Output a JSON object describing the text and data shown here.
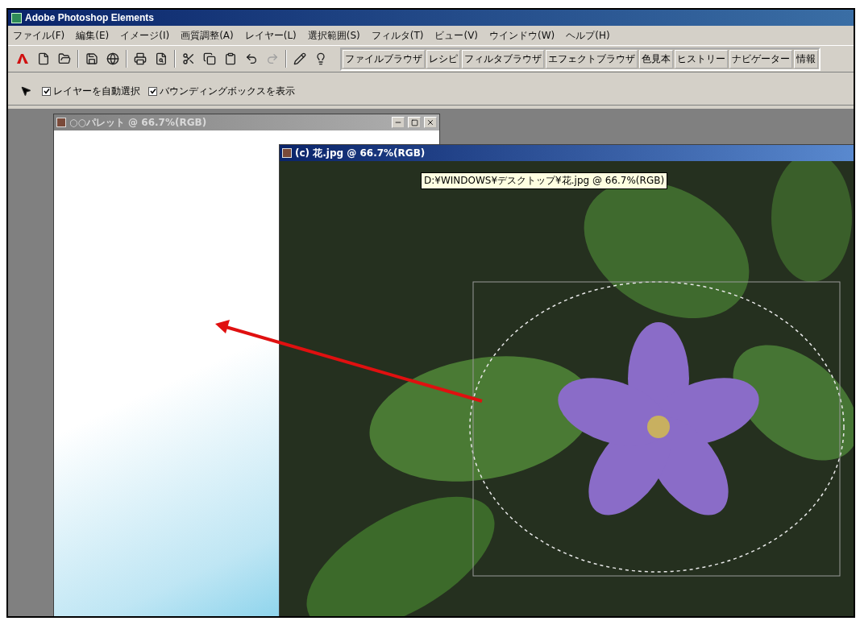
{
  "window": {
    "title": "Adobe Photoshop Elements"
  },
  "menu": [
    "ファイル(F)",
    "編集(E)",
    "イメージ(I)",
    "画質調整(A)",
    "レイヤー(L)",
    "選択範囲(S)",
    "フィルタ(T)",
    "ビュー(V)",
    "ウインドウ(W)",
    "ヘルプ(H)"
  ],
  "palette_tabs": [
    "ファイルブラウザ",
    "レシピ",
    "フィルタブラウザ",
    "エフェクトブラウザ",
    "色見本",
    "ヒストリー",
    "ナビゲーター",
    "情報"
  ],
  "options_bar": {
    "checkboxes": [
      {
        "label": "レイヤーを自動選択",
        "checked": true
      },
      {
        "label": "バウンディングボックスを表示",
        "checked": true
      }
    ]
  },
  "documents": [
    {
      "kind": "blank",
      "title": "○○パレット @ 66.7%(RGB)",
      "active": false
    },
    {
      "kind": "photo",
      "title": "(c) 花.jpg @ 66.7%(RGB)",
      "active": true,
      "tooltip": "D:¥WINDOWS¥デスクトップ¥花.jpg @ 66.7%(RGB)"
    }
  ]
}
